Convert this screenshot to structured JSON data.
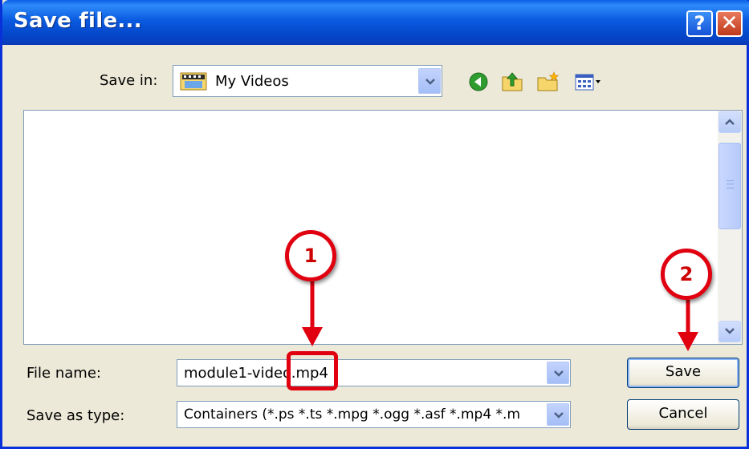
{
  "window": {
    "title": "Save file...",
    "help_glyph": "?",
    "close_glyph": "✕"
  },
  "save_in": {
    "label": "Save in:",
    "value": "My Videos",
    "folder_icon": "video-folder-icon"
  },
  "toolbar": {
    "icons": [
      "back-icon",
      "up-folder-icon",
      "new-folder-icon",
      "view-menu-icon"
    ]
  },
  "file_name": {
    "label": "File name:",
    "value": "module1-video.mp4"
  },
  "save_as_type": {
    "label": "Save as type:",
    "value": "Containers (*.ps *.ts *.mpg *.ogg *.asf *.mp4 *.m"
  },
  "buttons": {
    "save": "Save",
    "cancel": "Cancel"
  },
  "annotations": {
    "step1": "1",
    "step2": "2"
  },
  "colors": {
    "titlebar": "#0a5ae0",
    "annotation_red": "#e0000f",
    "dialog_bg": "#ece9d8"
  }
}
